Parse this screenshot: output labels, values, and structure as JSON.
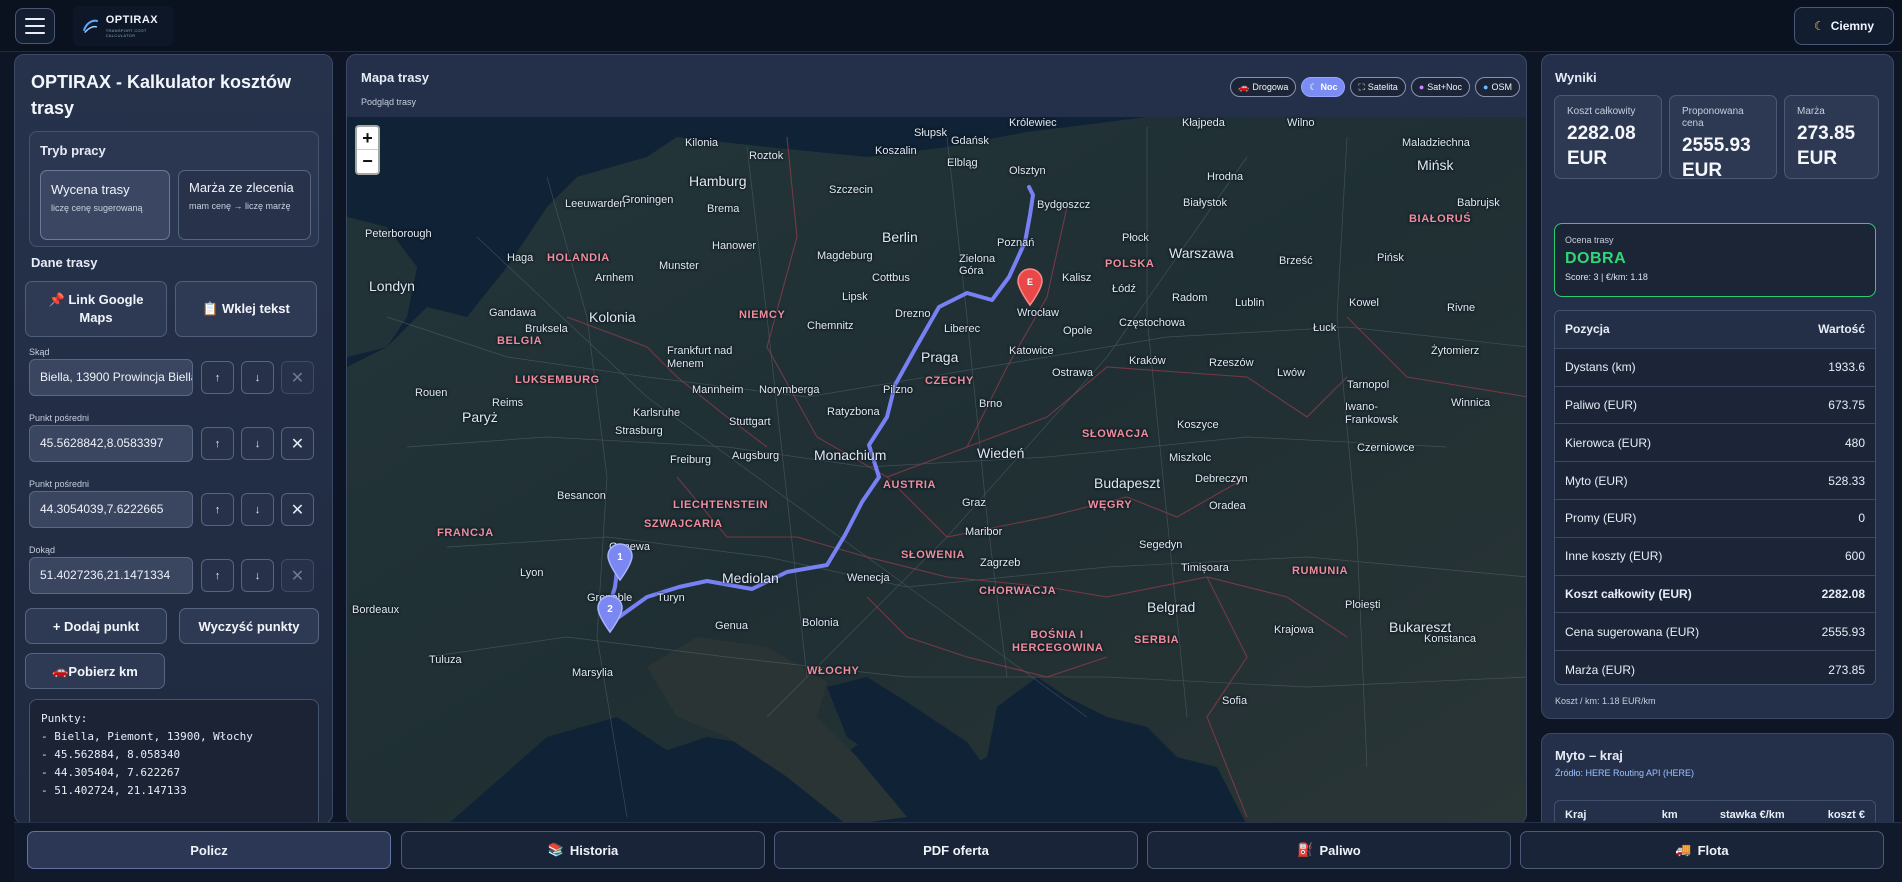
{
  "app": {
    "logo_text": "OPTIRAX",
    "logo_sub": "TRANSPORT COST CALCULATOR",
    "theme_label": "Ciemny"
  },
  "left": {
    "title": "OPTIRAX - Kalkulator kosztów trasy",
    "mode": {
      "title": "Tryb pracy",
      "option1_title": "Wycena trasy",
      "option1_sub": "liczę cenę sugerowaną",
      "option2_title": "Marża ze zlecenia",
      "option2_sub": "mam cenę → liczę marżę"
    },
    "route_title": "Dane trasy",
    "link_button": "Link Google Maps",
    "paste_button": "Wklej tekst",
    "fields": [
      {
        "label": "Skąd",
        "value": "Biella, 13900 Prowincja Biella, Włochy"
      },
      {
        "label": "Punkt pośredni",
        "value": "45.5628842,8.0583397"
      },
      {
        "label": "Punkt pośredni",
        "value": "44.3054039,7.6222665"
      },
      {
        "label": "Dokąd",
        "value": "51.4027236,21.1471334"
      }
    ],
    "add_point": "+ Dodaj punkt",
    "clear_points": "Wyczyść punkty",
    "fetch_km": "Pobierz km",
    "points_text": "Punkty:\n- Biella, Piemont, 13900, Włochy\n- 45.562884, 8.058340\n- 44.305404, 7.622267\n- 51.402724, 21.147133"
  },
  "map": {
    "title": "Mapa trasy",
    "subtitle": "Podgląd trasy",
    "layers": [
      "Drogowa",
      "Noc",
      "Satelita",
      "Sat+Noc",
      "OSM"
    ],
    "active_layer": "Noc",
    "zoom_in": "+",
    "zoom_out": "−",
    "markers": [
      "1",
      "2",
      "E"
    ],
    "labels": [
      {
        "t": "Królewiec",
        "c": ""
      },
      {
        "t": "Kłajpeda",
        "c": ""
      },
      {
        "t": "Wilno",
        "c": ""
      },
      {
        "t": "Maladziechna",
        "c": ""
      },
      {
        "t": "Gdańsk",
        "c": ""
      },
      {
        "t": "Olsztyn",
        "c": ""
      },
      {
        "t": "Elbląg",
        "c": ""
      },
      {
        "t": "Mińsk",
        "c": "big"
      },
      {
        "t": "Kilonia",
        "c": ""
      },
      {
        "t": "Roztok",
        "c": ""
      },
      {
        "t": "Koszalin",
        "c": ""
      },
      {
        "t": "Słupsk",
        "c": ""
      },
      {
        "t": "Hrodna",
        "c": ""
      },
      {
        "t": "Hamburg",
        "c": "big"
      },
      {
        "t": "Szczecin",
        "c": ""
      },
      {
        "t": "Białystok",
        "c": ""
      },
      {
        "t": "Babrujsk",
        "c": ""
      },
      {
        "t": "Groningen",
        "c": ""
      },
      {
        "t": "Brema",
        "c": ""
      },
      {
        "t": "Bydgoszcz",
        "c": ""
      },
      {
        "t": "Leeuwarden",
        "c": ""
      },
      {
        "t": "BIAŁORUŚ",
        "c": "country"
      },
      {
        "t": "Peterborough",
        "c": ""
      },
      {
        "t": "Berlin",
        "c": "big"
      },
      {
        "t": "Hanower",
        "c": ""
      },
      {
        "t": "Poznań",
        "c": ""
      },
      {
        "t": "Płock",
        "c": ""
      },
      {
        "t": "Haga",
        "c": ""
      },
      {
        "t": "HOLANDIA",
        "c": "country"
      },
      {
        "t": "Magdeburg",
        "c": ""
      },
      {
        "t": "Zielona Góra",
        "c": ""
      },
      {
        "t": "Warszawa",
        "c": "big"
      },
      {
        "t": "Brześć",
        "c": ""
      },
      {
        "t": "Pińsk",
        "c": ""
      },
      {
        "t": "Munster",
        "c": ""
      },
      {
        "t": "POLSKA",
        "c": "country"
      },
      {
        "t": "Londyn",
        "c": "big"
      },
      {
        "t": "Arnhem",
        "c": ""
      },
      {
        "t": "Cottbus",
        "c": ""
      },
      {
        "t": "Kalisz",
        "c": ""
      },
      {
        "t": "Łódź",
        "c": ""
      },
      {
        "t": "Radom",
        "c": ""
      },
      {
        "t": "Lublin",
        "c": ""
      },
      {
        "t": "Kowel",
        "c": ""
      },
      {
        "t": "Lipsk",
        "c": ""
      },
      {
        "t": "Wrocław",
        "c": ""
      },
      {
        "t": "Rivne",
        "c": ""
      },
      {
        "t": "Gandawa",
        "c": ""
      },
      {
        "t": "Kolonia",
        "c": "big"
      },
      {
        "t": "NIEMCY",
        "c": "country"
      },
      {
        "t": "Drezno",
        "c": ""
      },
      {
        "t": "Częstochowa",
        "c": ""
      },
      {
        "t": "Bruksela",
        "c": ""
      },
      {
        "t": "Opole",
        "c": ""
      },
      {
        "t": "Łuck",
        "c": ""
      },
      {
        "t": "BELGIA",
        "c": "country"
      },
      {
        "t": "Frankfurt nad Menem",
        "c": ""
      },
      {
        "t": "Chemnitz",
        "c": ""
      },
      {
        "t": "Liberec",
        "c": ""
      },
      {
        "t": "Katowice",
        "c": ""
      },
      {
        "t": "Kraków",
        "c": ""
      },
      {
        "t": "Rzeszów",
        "c": ""
      },
      {
        "t": "Żytomierz",
        "c": ""
      },
      {
        "t": "Praga",
        "c": "big"
      },
      {
        "t": "Ostrawa",
        "c": ""
      },
      {
        "t": "LUKSEMBURG",
        "c": "country"
      },
      {
        "t": "CZECHY",
        "c": "country"
      },
      {
        "t": "Lwów",
        "c": ""
      },
      {
        "t": "Mannheim",
        "c": ""
      },
      {
        "t": "Norymberga",
        "c": ""
      },
      {
        "t": "Pilzno",
        "c": ""
      },
      {
        "t": "Tarnopol",
        "c": ""
      },
      {
        "t": "Rouen",
        "c": ""
      },
      {
        "t": "Reims",
        "c": ""
      },
      {
        "t": "Karlsruhe",
        "c": ""
      },
      {
        "t": "Winnica",
        "c": ""
      },
      {
        "t": "Paryż",
        "c": "big"
      },
      {
        "t": "Ratyzbona",
        "c": ""
      },
      {
        "t": "Brno",
        "c": ""
      },
      {
        "t": "Stuttgart",
        "c": ""
      },
      {
        "t": "Iwano-Frankowsk",
        "c": ""
      },
      {
        "t": "Strasburg",
        "c": ""
      },
      {
        "t": "Koszyce",
        "c": ""
      },
      {
        "t": "SŁOWACJA",
        "c": "country"
      },
      {
        "t": "Monachium",
        "c": "big"
      },
      {
        "t": "Wiedeń",
        "c": "big"
      },
      {
        "t": "Miszkolc",
        "c": ""
      },
      {
        "t": "Freiburg",
        "c": ""
      },
      {
        "t": "Augsburg",
        "c": ""
      },
      {
        "t": "Czerniowce",
        "c": ""
      },
      {
        "t": "AUSTRIA",
        "c": "country"
      },
      {
        "t": "Budapeszt",
        "c": "big"
      },
      {
        "t": "Debreczyn",
        "c": ""
      },
      {
        "t": "Besancon",
        "c": ""
      },
      {
        "t": "LIECHTENSTEIN",
        "c": "country"
      },
      {
        "t": "Graz",
        "c": ""
      },
      {
        "t": "WĘGRY",
        "c": "country"
      },
      {
        "t": "FRANCJA",
        "c": "country"
      },
      {
        "t": "SZWAJCARIA",
        "c": "country"
      },
      {
        "t": "Oradea",
        "c": ""
      },
      {
        "t": "Maribor",
        "c": ""
      },
      {
        "t": "Genewa",
        "c": ""
      },
      {
        "t": "Segedyn",
        "c": ""
      },
      {
        "t": "SŁOWENIA",
        "c": "country"
      },
      {
        "t": "Lyon",
        "c": ""
      },
      {
        "t": "Mediolan",
        "c": "big"
      },
      {
        "t": "Wenecja",
        "c": ""
      },
      {
        "t": "Zagrzeb",
        "c": ""
      },
      {
        "t": "Timișoara",
        "c": ""
      },
      {
        "t": "RUMUNIA",
        "c": "country"
      },
      {
        "t": "Turyn",
        "c": ""
      },
      {
        "t": "CHORWACJA",
        "c": "country"
      },
      {
        "t": "Bordeaux",
        "c": ""
      },
      {
        "t": "Grenoble",
        "c": ""
      },
      {
        "t": "Belgrad",
        "c": "big"
      },
      {
        "t": "Ploiești",
        "c": ""
      },
      {
        "t": "Genua",
        "c": ""
      },
      {
        "t": "Bolonia",
        "c": ""
      },
      {
        "t": "Bukareszt",
        "c": "big"
      },
      {
        "t": "BOŚNIA I HERCEGOWINA",
        "c": "country"
      },
      {
        "t": "SERBIA",
        "c": "country"
      },
      {
        "t": "Krajowa",
        "c": ""
      },
      {
        "t": "Tuluza",
        "c": ""
      },
      {
        "t": "Marsylia",
        "c": ""
      },
      {
        "t": "WŁOCHY",
        "c": "country"
      },
      {
        "t": "Konstanca",
        "c": ""
      },
      {
        "t": "Sofia",
        "c": ""
      }
    ]
  },
  "results": {
    "title": "Wyniki",
    "kpis": [
      {
        "label": "Koszt całkowity",
        "value": "2282.08 EUR"
      },
      {
        "label": "Proponowana cena",
        "value": "2555.93 EUR"
      },
      {
        "label": "Marża",
        "value": "273.85 EUR"
      }
    ],
    "rating_label": "Ocena trasy",
    "rating_value": "DOBRA",
    "rating_sub": "Score: 3 | €/km: 1.18",
    "table_head": [
      "Pozycja",
      "Wartość"
    ],
    "rows": [
      {
        "k": "Dystans (km)",
        "v": "1933.6"
      },
      {
        "k": "Paliwo (EUR)",
        "v": "673.75"
      },
      {
        "k": "Kierowca (EUR)",
        "v": "480"
      },
      {
        "k": "Myto (EUR)",
        "v": "528.33"
      },
      {
        "k": "Promy (EUR)",
        "v": "0"
      },
      {
        "k": "Inne koszty (EUR)",
        "v": "600"
      },
      {
        "k": "Koszt całkowity (EUR)",
        "v": "2282.08"
      },
      {
        "k": "Cena sugerowana (EUR)",
        "v": "2555.93"
      },
      {
        "k": "Marża (EUR)",
        "v": "273.85"
      }
    ],
    "footer": "Koszt / km: 1.18 EUR/km"
  },
  "toll": {
    "title": "Myto – kraj",
    "source": "Źródło: HERE Routing API (HERE)",
    "headers": [
      "Kraj",
      "km",
      "stawka €/km",
      "koszt €"
    ]
  },
  "nav": [
    "Policz",
    "Historia",
    "PDF oferta",
    "Paliwo",
    "Flota"
  ],
  "colors": {
    "accent": "#7b8cf3",
    "route": "#7c86ff",
    "good": "#2fd776",
    "marker_end": "#e84848"
  }
}
